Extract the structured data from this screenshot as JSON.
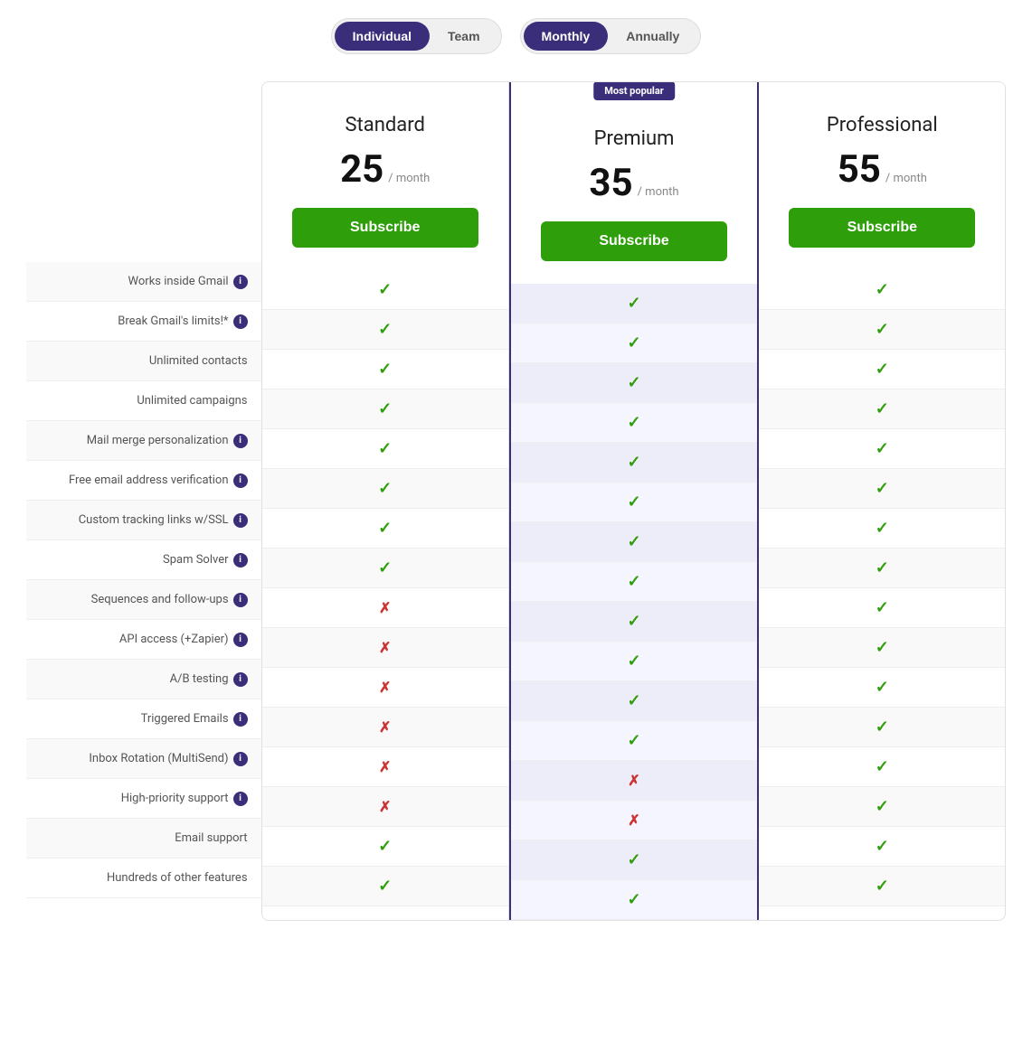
{
  "toggles": {
    "plan_type": {
      "options": [
        "Individual",
        "Team"
      ],
      "active": "Individual"
    },
    "billing": {
      "options": [
        "Monthly",
        "Annually"
      ],
      "active": "Monthly"
    }
  },
  "plans": [
    {
      "id": "standard",
      "name": "Standard",
      "price": "25",
      "period": "/ month",
      "featured": false,
      "subscribe_label": "Subscribe"
    },
    {
      "id": "premium",
      "name": "Premium",
      "price": "35",
      "period": "/ month",
      "featured": true,
      "most_popular_label": "Most popular",
      "subscribe_label": "Subscribe"
    },
    {
      "id": "professional",
      "name": "Professional",
      "price": "55",
      "period": "/ month",
      "featured": false,
      "subscribe_label": "Subscribe"
    }
  ],
  "features": [
    {
      "label": "Works inside Gmail",
      "info": true,
      "standard": "check",
      "premium": "check",
      "professional": "check"
    },
    {
      "label": "Break Gmail's limits!*",
      "info": true,
      "standard": "check",
      "premium": "check",
      "professional": "check"
    },
    {
      "label": "Unlimited contacts",
      "info": false,
      "standard": "check",
      "premium": "check",
      "professional": "check"
    },
    {
      "label": "Unlimited campaigns",
      "info": false,
      "standard": "check",
      "premium": "check",
      "professional": "check"
    },
    {
      "label": "Mail merge personalization",
      "info": true,
      "standard": "check",
      "premium": "check",
      "professional": "check"
    },
    {
      "label": "Free email address verification",
      "info": true,
      "standard": "check",
      "premium": "check",
      "professional": "check"
    },
    {
      "label": "Custom tracking links w/SSL",
      "info": true,
      "standard": "check",
      "premium": "check",
      "professional": "check"
    },
    {
      "label": "Spam Solver",
      "info": true,
      "standard": "check",
      "premium": "check",
      "professional": "check"
    },
    {
      "label": "Sequences and follow-ups",
      "info": true,
      "standard": "cross",
      "premium": "check",
      "professional": "check"
    },
    {
      "label": "API access (+Zapier)",
      "info": true,
      "standard": "cross",
      "premium": "check",
      "professional": "check"
    },
    {
      "label": "A/B testing",
      "info": true,
      "standard": "cross",
      "premium": "check",
      "professional": "check"
    },
    {
      "label": "Triggered Emails",
      "info": true,
      "standard": "cross",
      "premium": "check",
      "professional": "check"
    },
    {
      "label": "Inbox Rotation (MultiSend)",
      "info": true,
      "standard": "cross",
      "premium": "cross",
      "professional": "check"
    },
    {
      "label": "High-priority support",
      "info": true,
      "standard": "cross",
      "premium": "cross",
      "professional": "check"
    },
    {
      "label": "Email support",
      "info": false,
      "standard": "check",
      "premium": "check",
      "professional": "check"
    },
    {
      "label": "Hundreds of other features",
      "info": false,
      "standard": "check",
      "premium": "check",
      "professional": "check"
    }
  ],
  "icons": {
    "check": "✓",
    "cross": "✗",
    "info": "i"
  }
}
